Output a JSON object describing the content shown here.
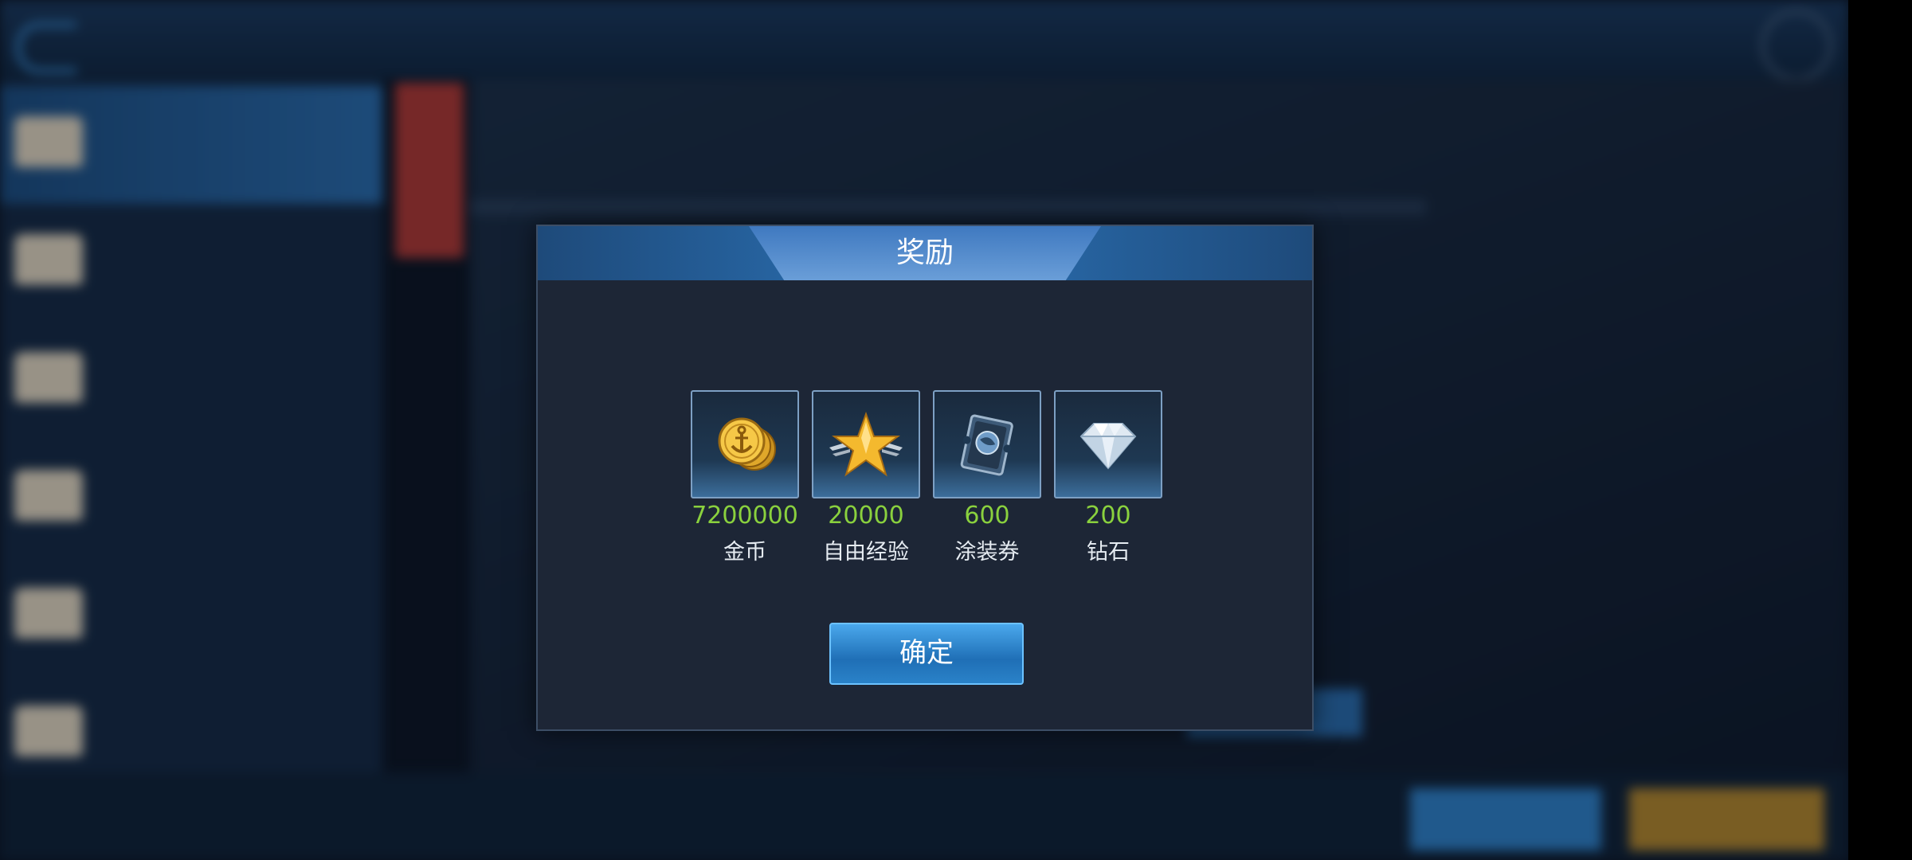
{
  "modal": {
    "title": "奖励",
    "confirm_label": "确定",
    "rewards": [
      {
        "icon": "gold-coin-icon",
        "amount": "7200000",
        "label": "金币"
      },
      {
        "icon": "free-exp-star-icon",
        "amount": "20000",
        "label": "自由经验"
      },
      {
        "icon": "paint-coupon-icon",
        "amount": "600",
        "label": "涂装券"
      },
      {
        "icon": "diamond-icon",
        "amount": "200",
        "label": "钻石"
      }
    ]
  },
  "colors": {
    "amount_green": "#8ad13e",
    "header_blue": "#2a6eb0",
    "button_blue": "#1f6fb6"
  }
}
